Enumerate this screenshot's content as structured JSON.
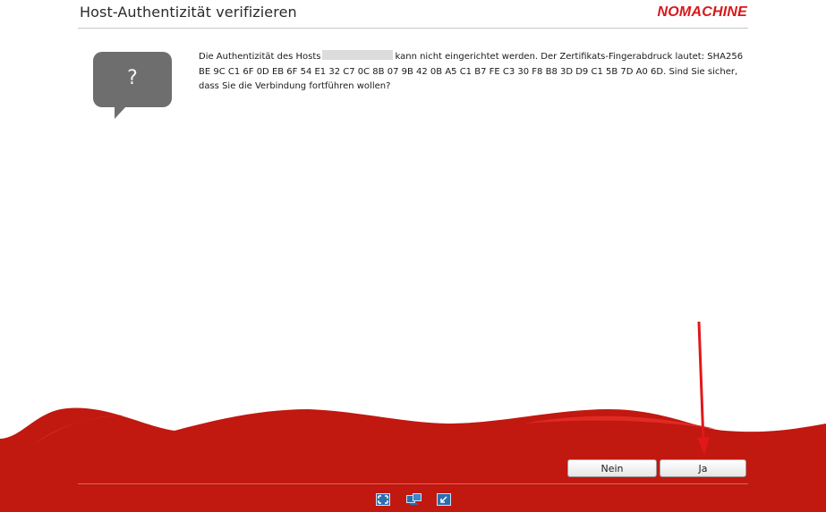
{
  "header": {
    "title": "Host-Authentizität verifizieren",
    "brand": "NOMACHINE"
  },
  "dialog": {
    "icon": "question-bubble-icon",
    "icon_glyph": "?",
    "message_part1": "Die Authentizität des Hosts",
    "message_part2": "kann nicht eingerichtet werden. Der Zertifikats-Fingerabdruck lautet: SHA256 BE 9C C1 6F 0D EB 6F 54 E1 32 C7 0C 8B 07 9B 42 0B A5 C1 B7 FE C3 30 F8 B8 3D D9 C1 5B 7D A0 6D. Sind Sie sicher, dass Sie die Verbindung fortführen wollen?"
  },
  "buttons": {
    "no_label": "Nein",
    "yes_label": "Ja"
  },
  "footer": {
    "icons": [
      "fullscreen-icon",
      "switch-display-icon",
      "minimize-icon"
    ]
  },
  "colors": {
    "brand_red": "#d8181a",
    "wave_red": "#c11810",
    "bubble_gray": "#6e6e6e"
  }
}
